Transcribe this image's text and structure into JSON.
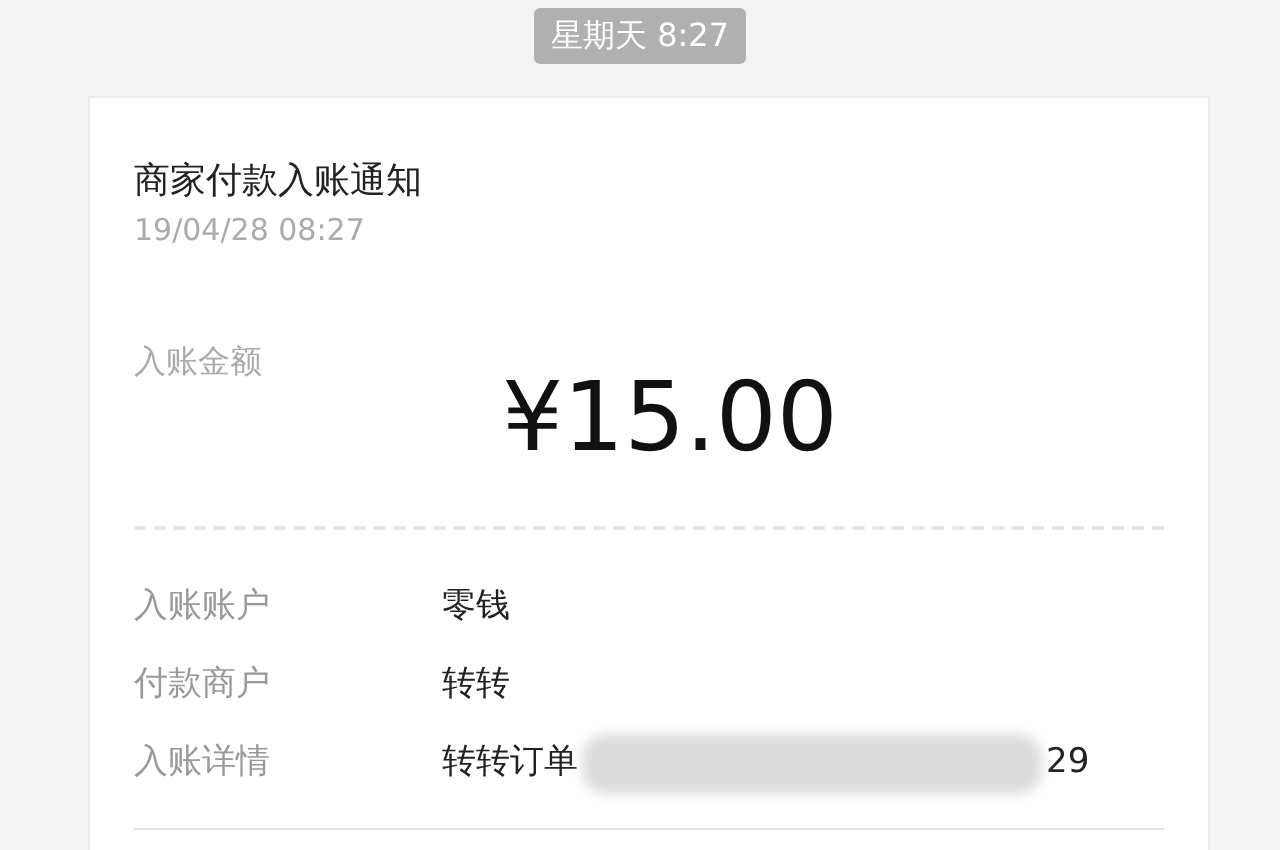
{
  "timestamp": "星期天 8:27",
  "card": {
    "title": "商家付款入账通知",
    "date": "19/04/28 08:27",
    "amount_label": "入账金额",
    "amount": "¥15.00",
    "rows": [
      {
        "label": "入账账户",
        "value": "零钱"
      },
      {
        "label": "付款商户",
        "value": "转转"
      },
      {
        "label": "入账详情",
        "value": "转转订单",
        "redacted": true,
        "value_end": "29"
      }
    ]
  }
}
